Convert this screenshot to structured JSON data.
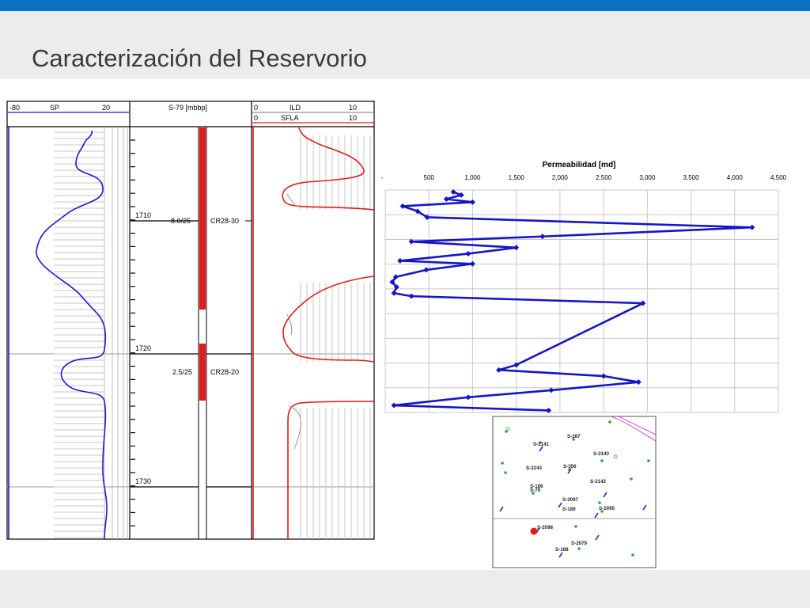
{
  "slide": {
    "title": "Caracterización del Reservorio"
  },
  "colors": {
    "accent_bar": "#0b72c2",
    "sp_curve": "#1a1ad0",
    "ild_curve": "#e51b1b",
    "perm_line": "#1515c8",
    "perforation": "#e51b1b"
  },
  "log": {
    "sp_track": {
      "min_label": "-80",
      "name": "SP",
      "max_label": "20"
    },
    "depth_track": {
      "header": "S-79 [mbbp]",
      "depth_labels": [
        "1710",
        "1720",
        "1730"
      ],
      "zones": [
        {
          "ratio": "8.0/25",
          "name": "CR28-30"
        },
        {
          "ratio": "2.5/25",
          "name": "CR28-20"
        }
      ]
    },
    "res_track": {
      "ild_min": "0",
      "ild_name": "ILD",
      "ild_max": "10",
      "sfla_min": "0",
      "sfla_name": "SFLA",
      "sfla_max": "10"
    }
  },
  "chart_data": {
    "type": "line",
    "title": "Permeabilidad [md]",
    "x_axis_position": "top",
    "xlim": [
      0,
      4500
    ],
    "x_ticks": [
      "-",
      "500",
      "1,000",
      "1,500",
      "2,000",
      "2,500",
      "3,000",
      "3,500",
      "4,000",
      "4,500"
    ],
    "grid": true,
    "series": [
      {
        "x": [
          780,
          870,
          700,
          1000,
          200,
          370,
          480,
          4200,
          1800,
          300,
          1500,
          950,
          170,
          1000,
          470,
          120,
          80,
          130,
          100,
          300,
          2950,
          1500,
          1300,
          2500,
          2900,
          1900,
          950,
          100,
          1870
        ],
        "depth_index": [
          0.2,
          0.5,
          0.9,
          1.2,
          1.6,
          2.1,
          2.7,
          3.7,
          4.6,
          5.1,
          5.7,
          6.3,
          7.0,
          7.3,
          7.9,
          8.6,
          9.1,
          9.6,
          10.2,
          10.5,
          11.2,
          17.3,
          17.8,
          18.4,
          19.0,
          19.8,
          20.5,
          21.3,
          21.8
        ]
      }
    ]
  },
  "map": {
    "wells": [
      {
        "label": "S-287"
      },
      {
        "label": "S-2141"
      },
      {
        "label": "S-2143"
      },
      {
        "label": "S-2243"
      },
      {
        "label": "S-356"
      },
      {
        "label": "S-2142"
      },
      {
        "label": "S-186"
      },
      {
        "label": "S-79"
      },
      {
        "label": "S-2097"
      },
      {
        "label": "S-189"
      },
      {
        "label": "S-2095"
      },
      {
        "label": "S-2098"
      },
      {
        "label": "S-2079"
      },
      {
        "label": "S-188"
      }
    ]
  }
}
